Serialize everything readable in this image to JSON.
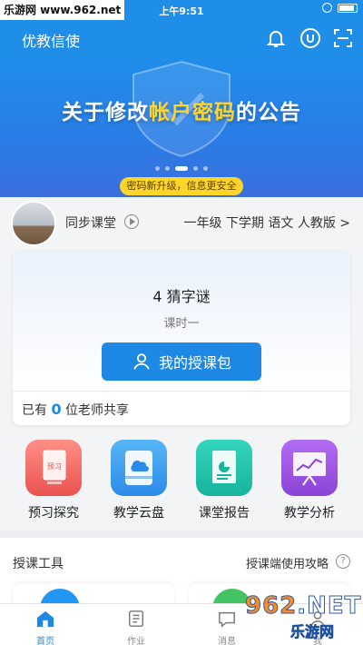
{
  "status_bar": {
    "time": "上午9:51"
  },
  "watermark": {
    "top": "乐游网 www.962.net",
    "brand_num": "962",
    "brand_tld": ".NET",
    "brand_cn": "乐游网"
  },
  "header": {
    "title": "优教信使",
    "icons": [
      "bell-icon",
      "user-circle-icon",
      "scan-icon"
    ]
  },
  "banner": {
    "title_a": "关于修改",
    "title_hl": "帐户密码",
    "title_b": "的公告",
    "subtitle": "密码新升级，信息更安全",
    "dots_total": 5,
    "dots_active": 2
  },
  "course": {
    "label": "同步课堂",
    "meta": "一年级 下学期 语文 人教版 >"
  },
  "lesson": {
    "title": "4 猜字谜",
    "subtitle": "课时一",
    "button_label": "我的授课包",
    "share_prefix": "已有",
    "share_count": "0",
    "share_suffix": "位老师共享"
  },
  "features": [
    {
      "label": "预习探究",
      "icon": "preview-doc-icon"
    },
    {
      "label": "教学云盘",
      "icon": "cloud-drive-icon"
    },
    {
      "label": "课堂报告",
      "icon": "report-icon"
    },
    {
      "label": "教学分析",
      "icon": "analysis-board-icon"
    }
  ],
  "preview_icon_text": "预习",
  "tools": {
    "title": "授课工具",
    "link": "授课端使用攻略",
    "help": "?"
  },
  "tabs": [
    {
      "label": "首页",
      "active": true
    },
    {
      "label": "作业",
      "active": false
    },
    {
      "label": "消息",
      "active": false
    },
    {
      "label": "我",
      "active": false
    }
  ],
  "colors": {
    "primary": "#1f8ee9",
    "button": "#1e88e5",
    "highlight": "#ffd52a"
  }
}
